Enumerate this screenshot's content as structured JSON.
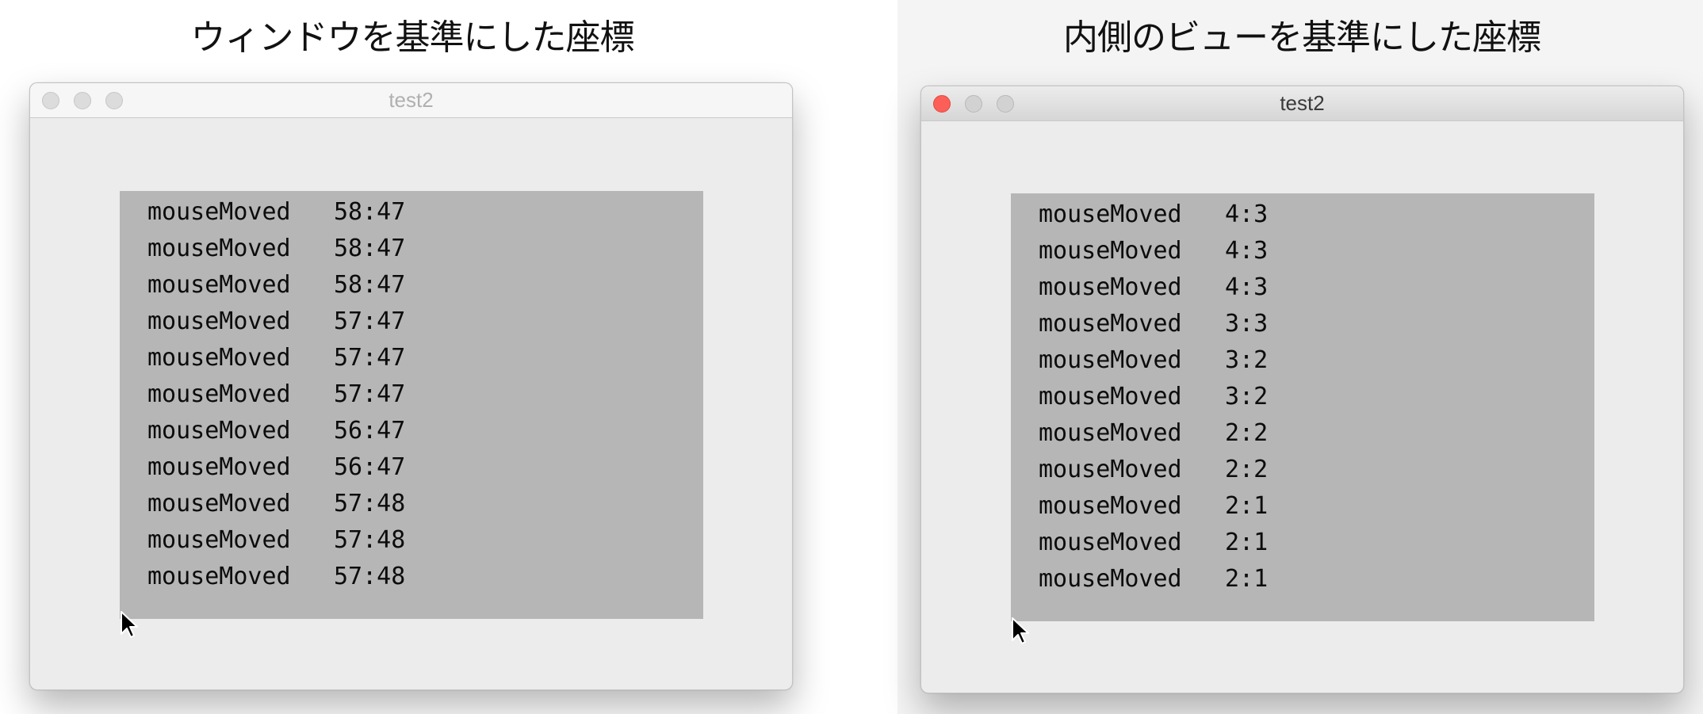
{
  "left": {
    "caption": "ウィンドウを基準にした座標",
    "window_title": "test2",
    "log": [
      {
        "event": "mouseMoved",
        "coords": "58:47"
      },
      {
        "event": "mouseMoved",
        "coords": "58:47"
      },
      {
        "event": "mouseMoved",
        "coords": "58:47"
      },
      {
        "event": "mouseMoved",
        "coords": "57:47"
      },
      {
        "event": "mouseMoved",
        "coords": "57:47"
      },
      {
        "event": "mouseMoved",
        "coords": "57:47"
      },
      {
        "event": "mouseMoved",
        "coords": "56:47"
      },
      {
        "event": "mouseMoved",
        "coords": "56:47"
      },
      {
        "event": "mouseMoved",
        "coords": "57:48"
      },
      {
        "event": "mouseMoved",
        "coords": "57:48"
      },
      {
        "event": "mouseMoved",
        "coords": "57:48"
      }
    ]
  },
  "right": {
    "caption": "内側のビューを基準にした座標",
    "window_title": "test2",
    "log": [
      {
        "event": "mouseMoved",
        "coords": "4:3"
      },
      {
        "event": "mouseMoved",
        "coords": "4:3"
      },
      {
        "event": "mouseMoved",
        "coords": "4:3"
      },
      {
        "event": "mouseMoved",
        "coords": "3:3"
      },
      {
        "event": "mouseMoved",
        "coords": "3:2"
      },
      {
        "event": "mouseMoved",
        "coords": "3:2"
      },
      {
        "event": "mouseMoved",
        "coords": "2:2"
      },
      {
        "event": "mouseMoved",
        "coords": "2:2"
      },
      {
        "event": "mouseMoved",
        "coords": "2:1"
      },
      {
        "event": "mouseMoved",
        "coords": "2:1"
      },
      {
        "event": "mouseMoved",
        "coords": "2:1"
      }
    ]
  },
  "colors": {
    "close_button_active": "#fc5f57",
    "log_view_background": "#b6b6b6",
    "window_background": "#ececec"
  },
  "icons": [
    "close-icon",
    "minimize-icon",
    "zoom-icon",
    "mouse-pointer-icon"
  ]
}
